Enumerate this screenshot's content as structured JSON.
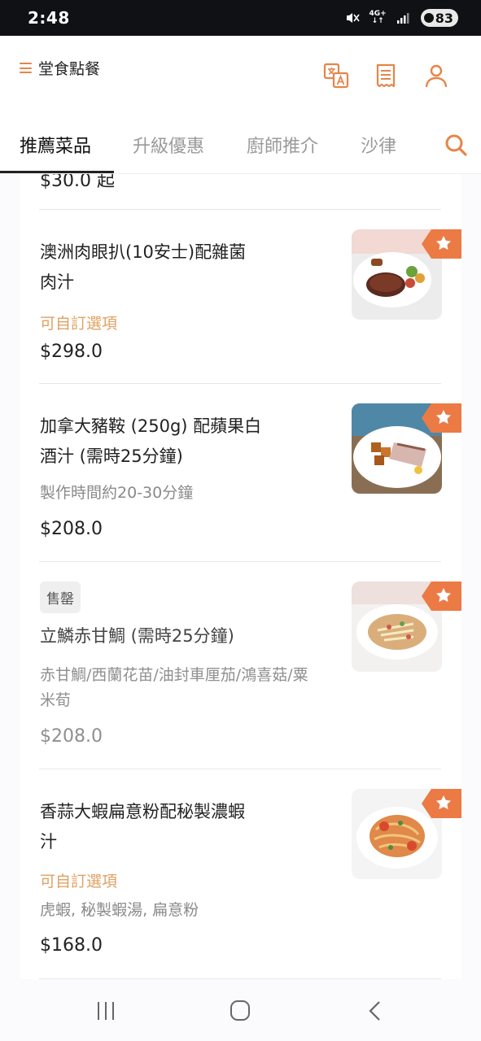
{
  "status_bar": {
    "time": "2:48",
    "network": "4G+",
    "battery": "83"
  },
  "header": {
    "title": "堂食點餐",
    "icons": [
      "menu-icon",
      "translate-icon",
      "receipt-icon",
      "user-icon"
    ]
  },
  "tabs": [
    {
      "label": "推薦菜品",
      "active": true
    },
    {
      "label": "升級優惠",
      "active": false
    },
    {
      "label": "廚師推介",
      "active": false
    },
    {
      "label": "沙律",
      "active": false
    }
  ],
  "partial_price": "$30.0 起",
  "items": [
    {
      "name_line1": "澳洲肉眼扒(10安士)配雜菌",
      "name_line2": "肉汁",
      "option_label": "可自訂選項",
      "price": "$298.0",
      "sold_out": false
    },
    {
      "name_line1": "加拿大豬鞍 (250g) 配蘋果白",
      "name_line2": "酒汁 (需時25分鐘)",
      "description": "製作時間約20-30分鐘",
      "price": "$208.0",
      "sold_out": false
    },
    {
      "sold_out_label": "售罄",
      "name_line1": "立鱗赤甘鯛 (需時25分鐘)",
      "description_line1": "赤甘鯛/西蘭花苗/油封車厘茄/鴻喜菇/粟",
      "description_line2": "米荀",
      "price": "$208.0",
      "sold_out": true
    },
    {
      "name_line1": "香蒜大蝦扁意粉配秘製濃蝦",
      "name_line2": "汁",
      "option_label": "可自訂選項",
      "description": "虎蝦, 秘製蝦湯, 扁意粉",
      "price": "$168.0",
      "sold_out": false
    }
  ],
  "colors": {
    "accent": "#e4854a",
    "option": "#e0a162",
    "star_tag": "#ec7a45"
  }
}
